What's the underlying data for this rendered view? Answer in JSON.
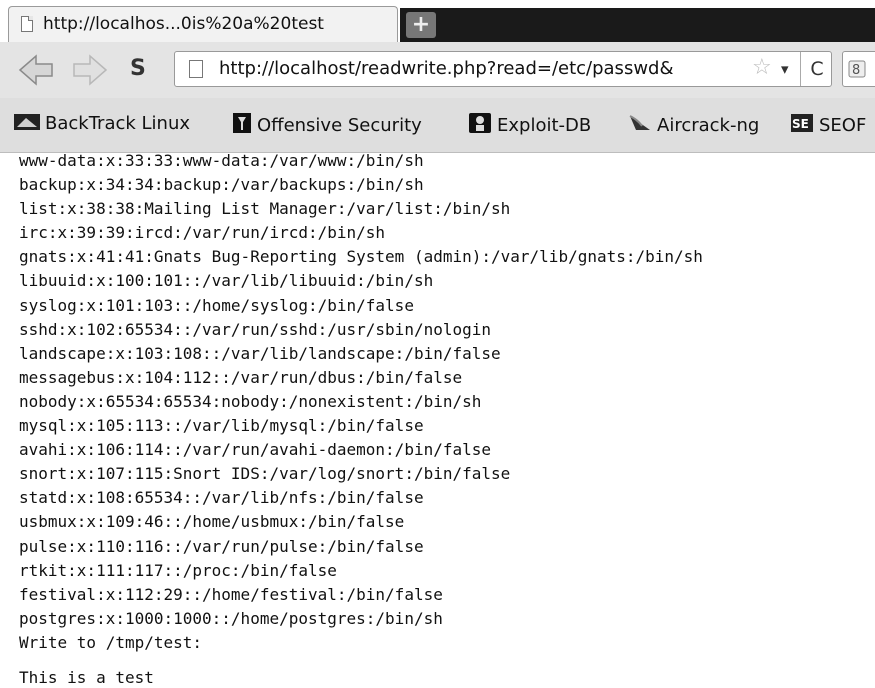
{
  "tab": {
    "title": "http://localhos...0is%20a%20test"
  },
  "toolbar": {
    "new_tab_label": "+",
    "s_button_label": "S",
    "url": "http://localhost/readwrite.php?read=/etc/passwd&",
    "reload_label": "C",
    "dropdown_label": "▾"
  },
  "bookmarks": [
    {
      "label": "BackTrack Linux",
      "icon": "backtrack-icon"
    },
    {
      "label": "Offensive Security",
      "icon": "offsec-icon"
    },
    {
      "label": "Exploit-DB",
      "icon": "exploit-db-icon"
    },
    {
      "label": "Aircrack-ng",
      "icon": "aircrack-icon"
    },
    {
      "label": "SEOF",
      "icon": "seo-icon"
    }
  ],
  "content": {
    "lines": [
      "www-data:x:33:33:www-data:/var/www:/bin/sh",
      "backup:x:34:34:backup:/var/backups:/bin/sh",
      "list:x:38:38:Mailing List Manager:/var/list:/bin/sh",
      "irc:x:39:39:ircd:/var/run/ircd:/bin/sh",
      "gnats:x:41:41:Gnats Bug-Reporting System (admin):/var/lib/gnats:/bin/sh",
      "libuuid:x:100:101::/var/lib/libuuid:/bin/sh",
      "syslog:x:101:103::/home/syslog:/bin/false",
      "sshd:x:102:65534::/var/run/sshd:/usr/sbin/nologin",
      "landscape:x:103:108::/var/lib/landscape:/bin/false",
      "messagebus:x:104:112::/var/run/dbus:/bin/false",
      "nobody:x:65534:65534:nobody:/nonexistent:/bin/sh",
      "mysql:x:105:113::/var/lib/mysql:/bin/false",
      "avahi:x:106:114::/var/run/avahi-daemon:/bin/false",
      "snort:x:107:115:Snort IDS:/var/log/snort:/bin/false",
      "statd:x:108:65534::/var/lib/nfs:/bin/false",
      "usbmux:x:109:46::/home/usbmux:/bin/false",
      "pulse:x:110:116::/var/run/pulse:/bin/false",
      "rtkit:x:111:117::/proc:/bin/false",
      "festival:x:112:29::/home/festival:/bin/false",
      "postgres:x:1000:1000::/home/postgres:/bin/sh",
      "Write to /tmp/test:"
    ],
    "test_text": "This is a test"
  }
}
